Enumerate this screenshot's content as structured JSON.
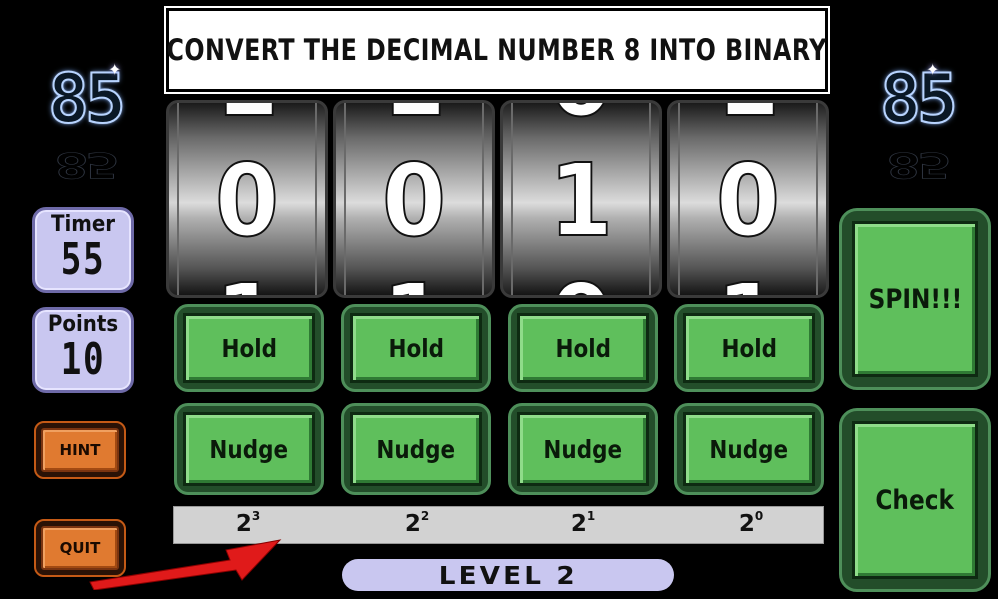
{
  "question": "CONVERT THE DECIMAL NUMBER 8 INTO BINARY",
  "score_left": "85",
  "score_right": "85",
  "timer": {
    "label": "Timer",
    "value": "55"
  },
  "points": {
    "label": "Points",
    "value": "10"
  },
  "hint_label": "HINT",
  "quit_label": "QUIT",
  "reels": [
    {
      "main": "0",
      "above": "1",
      "below": "1"
    },
    {
      "main": "0",
      "above": "1",
      "below": "1"
    },
    {
      "main": "1",
      "above": "0",
      "below": "0"
    },
    {
      "main": "0",
      "above": "1",
      "below": "1"
    }
  ],
  "hold_labels": [
    "Hold",
    "Hold",
    "Hold",
    "Hold"
  ],
  "nudge_labels": [
    "Nudge",
    "Nudge",
    "Nudge",
    "Nudge"
  ],
  "spin_label": "SPIN!!!",
  "check_label": "Check",
  "powers": [
    {
      "base": "2",
      "exp": "3"
    },
    {
      "base": "2",
      "exp": "2"
    },
    {
      "base": "2",
      "exp": "1"
    },
    {
      "base": "2",
      "exp": "0"
    }
  ],
  "level_label": "LEVEL 2",
  "colors": {
    "arrow": "#e01a1a",
    "button_green": "#5fbf5c",
    "button_orange": "#e07a30",
    "panel_lavender": "#c9c7f0"
  }
}
